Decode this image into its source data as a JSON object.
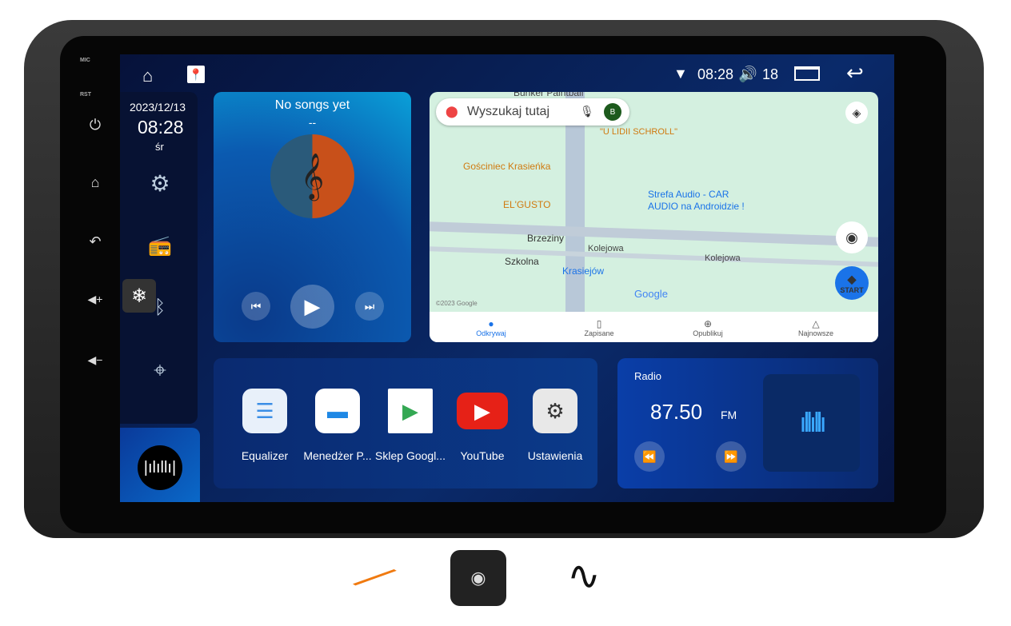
{
  "hardware": {
    "mic_label": "MIC",
    "rst_label": "RST"
  },
  "status_bar": {
    "time": "08:28",
    "volume": "18",
    "wifi_icon": "wifi-icon"
  },
  "sidebar": {
    "date": "2023/12/13",
    "time": "08:28",
    "weekday": "śr"
  },
  "music": {
    "title": "No songs yet",
    "artist": "--"
  },
  "map": {
    "search_placeholder": "Wyszukaj tutaj",
    "avatar_letter": "B",
    "labels": [
      "Bunker Paintball",
      "\"U LIDII SCHROLL\"",
      "Gościniec Krasieńka",
      "EL'GUSTO",
      "Strefa Audio - CAR AUDIO na Androidzie !",
      "Brzeziny",
      "Kolejowa",
      "Kolejowa",
      "Szkolna",
      "Krasiejów",
      "Google",
      "©2023 Google"
    ],
    "start_label": "START",
    "nav": [
      {
        "label": "Odkrywaj",
        "icon": "pin-icon"
      },
      {
        "label": "Zapisane",
        "icon": "bookmark-icon"
      },
      {
        "label": "Opublikuj",
        "icon": "plus-circle-icon"
      },
      {
        "label": "Najnowsze",
        "icon": "bell-icon"
      }
    ]
  },
  "apps": [
    {
      "label": "Equalizer"
    },
    {
      "label": "Menedżer P..."
    },
    {
      "label": "Sklep Googl..."
    },
    {
      "label": "YouTube"
    },
    {
      "label": "Ustawienia"
    }
  ],
  "radio": {
    "title": "Radio",
    "frequency": "87.50",
    "band": "FM"
  },
  "colors": {
    "accent": "#1a73e8",
    "youtube": "#e62117"
  }
}
